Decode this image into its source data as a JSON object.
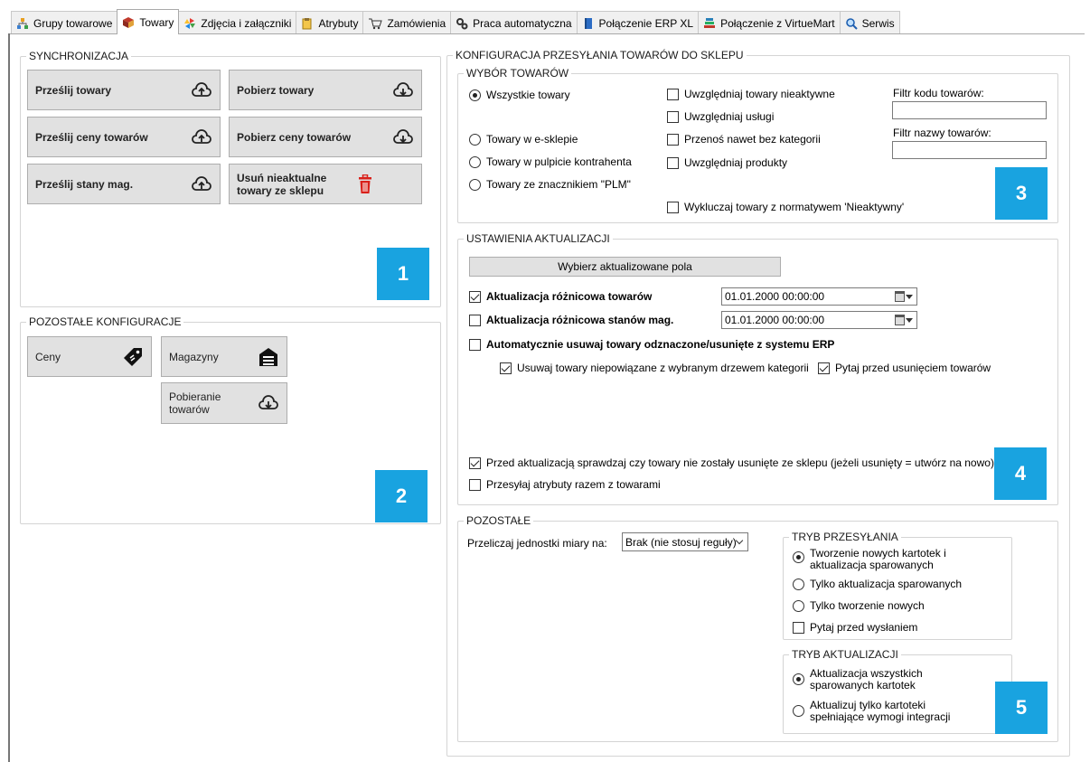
{
  "tabs": [
    {
      "label": "Grupy towarowe",
      "icon": "groups-icon"
    },
    {
      "label": "Towary",
      "icon": "products-icon"
    },
    {
      "label": "Zdjęcia i załączniki",
      "icon": "pinwheel-icon"
    },
    {
      "label": "Atrybuty",
      "icon": "attributes-icon"
    },
    {
      "label": "Zamówienia",
      "icon": "cart-icon"
    },
    {
      "label": "Praca automatyczna",
      "icon": "gears-icon"
    },
    {
      "label": "Połączenie ERP XL",
      "icon": "book-icon"
    },
    {
      "label": "Połączenie z VirtueMart",
      "icon": "books-icon"
    },
    {
      "label": "Serwis",
      "icon": "magnifier-icon"
    }
  ],
  "active_tab": "Towary",
  "sync": {
    "title": "SYNCHRONIZACJA",
    "send_products": "Prześlij towary",
    "get_products": "Pobierz towary",
    "send_prices": "Prześlij ceny towarów",
    "get_prices": "Pobierz ceny towarów",
    "send_stock": "Prześlij stany mag.",
    "remove_outdated": "Usuń nieaktualne towary ze sklepu",
    "badge": "1"
  },
  "other_config": {
    "title": "POZOSTAŁE KONFIGURACJE",
    "prices": "Ceny",
    "warehouses": "Magazyny",
    "fetching": "Pobieranie towarów",
    "badge": "2"
  },
  "config": {
    "title": "KONFIGURACJA PRZESYŁANIA TOWARÓW DO SKLEPU",
    "selection": {
      "title": "WYBÓR TOWARÓW",
      "radios": [
        "Wszystkie towary",
        "Towary w e-sklepie",
        "Towary w pulpicie kontrahenta",
        "Towary ze znacznikiem \"PLM\""
      ],
      "selected_radio": 0,
      "checks": [
        {
          "label": "Uwzględniaj towary nieaktywne",
          "checked": false
        },
        {
          "label": "Uwzględniaj usługi",
          "checked": false
        },
        {
          "label": "Przenoś nawet bez kategorii",
          "checked": false
        },
        {
          "label": "Uwzględniaj produkty",
          "checked": false
        }
      ],
      "exclude": {
        "label": "Wykluczaj towary z normatywem 'Nieaktywny'",
        "checked": false
      },
      "code_filter_label": "Filtr kodu towarów:",
      "code_filter_value": "",
      "name_filter_label": "Filtr nazwy towarów:",
      "name_filter_value": "",
      "badge": "3"
    },
    "update": {
      "title": "USTAWIENIA AKTUALIZACJI",
      "choose_fields": "Wybierz aktualizowane pola",
      "diff_products": {
        "label": "Aktualizacja różnicowa towarów",
        "checked": true,
        "date": "01.01.2000 00:00:00"
      },
      "diff_stock": {
        "label": "Aktualizacja różnicowa stanów mag.",
        "checked": false,
        "date": "01.01.2000 00:00:00"
      },
      "auto_remove": {
        "label": "Automatycznie usuwaj towary odznaczone/usunięte z systemu ERP",
        "checked": false
      },
      "remove_unlinked": {
        "label": "Usuwaj towary niepowiązane z wybranym drzewem kategorii",
        "checked": true
      },
      "ask_before_remove": {
        "label": "Pytaj przed usunięciem towarów",
        "checked": true
      },
      "check_deleted": {
        "label": "Przed aktualizacją sprawdzaj czy towary nie zostały usunięte ze sklepu (jeżeli usunięty = utwórz na nowo)",
        "checked": true
      },
      "send_attributes": {
        "label": "Przesyłaj atrybuty razem z towarami",
        "checked": false
      },
      "badge": "4"
    },
    "other": {
      "title": "POZOSTAŁE",
      "units_label": "Przeliczaj jednostki miary na:",
      "units_value": "Brak (nie stosuj reguły)",
      "send_mode": {
        "title": "TRYB PRZESYŁANIA",
        "options": [
          "Tworzenie nowych kartotek i aktualizacja sparowanych",
          "Tylko aktualizacja sparowanych",
          "Tylko tworzenie nowych"
        ],
        "selected": 0,
        "ask_before_send": {
          "label": "Pytaj przed wysłaniem",
          "checked": false
        }
      },
      "update_mode": {
        "title": "TRYB AKTUALIZACJI",
        "options": [
          "Aktualizacja wszystkich sparowanych kartotek",
          "Aktualizuj tylko kartoteki spełniające wymogi integracji"
        ],
        "selected": 0
      },
      "badge": "5"
    }
  },
  "colors": {
    "badge": "#19a3e0",
    "delete_icon": "#d9201a"
  }
}
